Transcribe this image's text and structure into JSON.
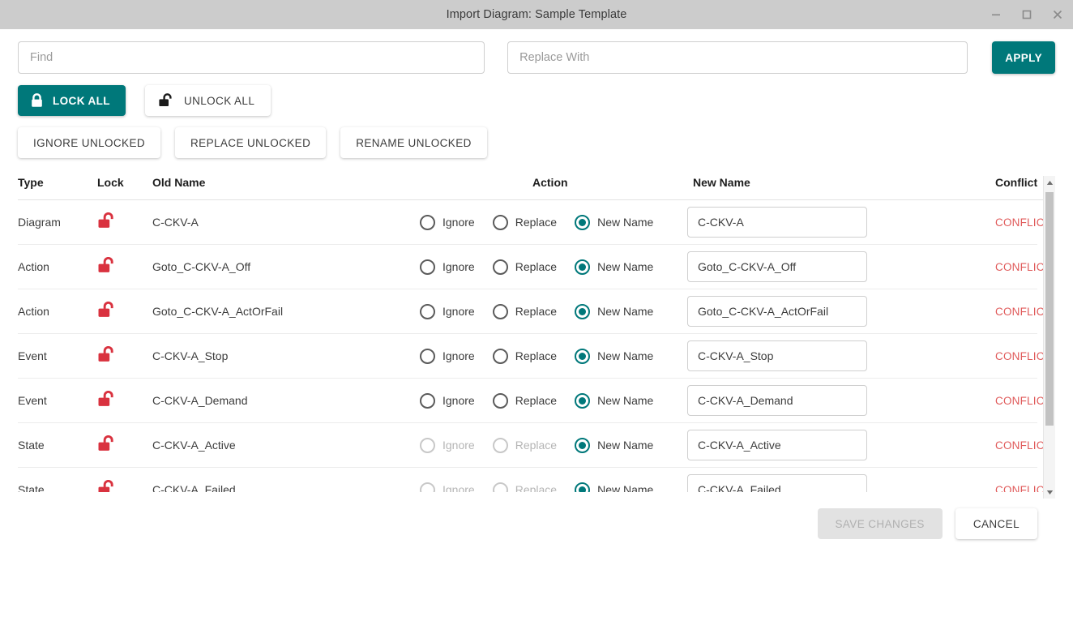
{
  "window": {
    "title": "Import Diagram: Sample Template",
    "minimize_icon": "minimize-icon",
    "maximize_icon": "maximize-icon",
    "close_icon": "close-icon"
  },
  "toolbar": {
    "find_placeholder": "Find",
    "find_value": "",
    "replace_placeholder": "Replace With",
    "replace_value": "",
    "apply_label": "APPLY",
    "lock_all_label": "LOCK ALL",
    "unlock_all_label": "UNLOCK ALL",
    "ignore_unlocked_label": "IGNORE UNLOCKED",
    "replace_unlocked_label": "REPLACE UNLOCKED",
    "rename_unlocked_label": "RENAME UNLOCKED"
  },
  "table": {
    "headers": {
      "type": "Type",
      "lock": "Lock",
      "old_name": "Old Name",
      "action": "Action",
      "new_name": "New Name",
      "conflict": "Conflict"
    },
    "action_options": {
      "ignore": "Ignore",
      "replace": "Replace",
      "new_name": "New Name"
    },
    "rows": [
      {
        "type": "Diagram",
        "lock_icon": "unlocked-padlock-icon",
        "old_name": "C-CKV-A",
        "selected_action": "new_name",
        "ignore_disabled": false,
        "replace_disabled": false,
        "new_name": "C-CKV-A",
        "conflict": "CONFLICTS"
      },
      {
        "type": "Action",
        "lock_icon": "unlocked-padlock-icon",
        "old_name": "Goto_C-CKV-A_Off",
        "selected_action": "new_name",
        "ignore_disabled": false,
        "replace_disabled": false,
        "new_name": "Goto_C-CKV-A_Off",
        "conflict": "CONFLICTS"
      },
      {
        "type": "Action",
        "lock_icon": "unlocked-padlock-icon",
        "old_name": "Goto_C-CKV-A_ActOrFail",
        "selected_action": "new_name",
        "ignore_disabled": false,
        "replace_disabled": false,
        "new_name": "Goto_C-CKV-A_ActOrFail",
        "conflict": "CONFLICTS"
      },
      {
        "type": "Event",
        "lock_icon": "unlocked-padlock-icon",
        "old_name": "C-CKV-A_Stop",
        "selected_action": "new_name",
        "ignore_disabled": false,
        "replace_disabled": false,
        "new_name": "C-CKV-A_Stop",
        "conflict": "CONFLICTS"
      },
      {
        "type": "Event",
        "lock_icon": "unlocked-padlock-icon",
        "old_name": "C-CKV-A_Demand",
        "selected_action": "new_name",
        "ignore_disabled": false,
        "replace_disabled": false,
        "new_name": "C-CKV-A_Demand",
        "conflict": "CONFLICTS"
      },
      {
        "type": "State",
        "lock_icon": "unlocked-padlock-icon",
        "old_name": "C-CKV-A_Active",
        "selected_action": "new_name",
        "ignore_disabled": true,
        "replace_disabled": true,
        "new_name": "C-CKV-A_Active",
        "conflict": "CONFLICTS"
      },
      {
        "type": "State",
        "lock_icon": "unlocked-padlock-icon",
        "old_name": "C-CKV-A_Failed",
        "selected_action": "new_name",
        "ignore_disabled": true,
        "replace_disabled": true,
        "new_name": "C-CKV-A_Failed",
        "conflict": "CONFLICTS"
      }
    ]
  },
  "footer": {
    "save_label": "SAVE CHANGES",
    "save_disabled": true,
    "cancel_label": "CANCEL"
  },
  "colors": {
    "accent_teal": "#00787a",
    "conflict_red": "#e05a5a",
    "lock_red": "#d9323f",
    "titlebar": "#cccccc"
  }
}
